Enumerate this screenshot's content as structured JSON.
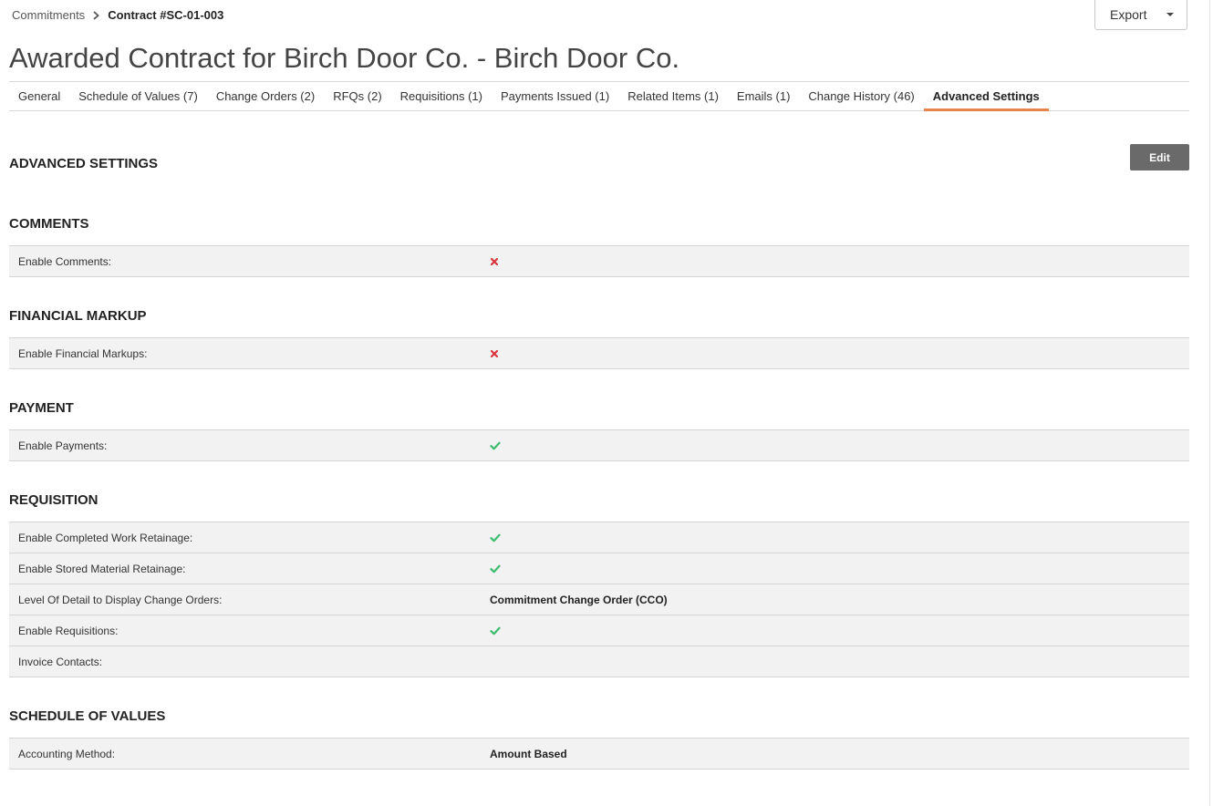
{
  "breadcrumb": {
    "parent": "Commitments",
    "current": "Contract #SC-01-003"
  },
  "export_button": {
    "label": "Export"
  },
  "title": "Awarded Contract for Birch Door Co. - Birch Door Co.",
  "tabs": [
    {
      "label": "General"
    },
    {
      "label": "Schedule of Values (7)"
    },
    {
      "label": "Change Orders (2)"
    },
    {
      "label": "RFQs (2)"
    },
    {
      "label": "Requisitions (1)"
    },
    {
      "label": "Payments Issued (1)"
    },
    {
      "label": "Related Items (1)"
    },
    {
      "label": "Emails (1)"
    },
    {
      "label": "Change History (46)"
    },
    {
      "label": "Advanced Settings",
      "active": true
    }
  ],
  "main_heading": "ADVANCED SETTINGS",
  "edit_button": {
    "label": "Edit"
  },
  "colors": {
    "active_tab_underline": "#e8834e",
    "check": "#3dbb6e",
    "cross": "#d9363e"
  },
  "sections": {
    "comments": {
      "title": "COMMENTS",
      "rows": [
        {
          "label": "Enable Comments:",
          "icon": "cross-icon"
        }
      ]
    },
    "financial_markup": {
      "title": "FINANCIAL MARKUP",
      "rows": [
        {
          "label": "Enable Financial Markups:",
          "icon": "cross-icon"
        }
      ]
    },
    "payment": {
      "title": "PAYMENT",
      "rows": [
        {
          "label": "Enable Payments:",
          "icon": "check-icon"
        }
      ]
    },
    "requisition": {
      "title": "REQUISITION",
      "rows": [
        {
          "label": "Enable Completed Work Retainage:",
          "icon": "check-icon"
        },
        {
          "label": "Enable Stored Material Retainage:",
          "icon": "check-icon"
        },
        {
          "label": "Level Of Detail to Display Change Orders:",
          "value": "Commitment Change Order (CCO)"
        },
        {
          "label": "Enable Requisitions:",
          "icon": "check-icon"
        },
        {
          "label": "Invoice Contacts:",
          "value": ""
        }
      ]
    },
    "schedule_of_values": {
      "title": "SCHEDULE OF VALUES",
      "rows": [
        {
          "label": "Accounting Method:",
          "value": "Amount Based"
        }
      ]
    }
  }
}
